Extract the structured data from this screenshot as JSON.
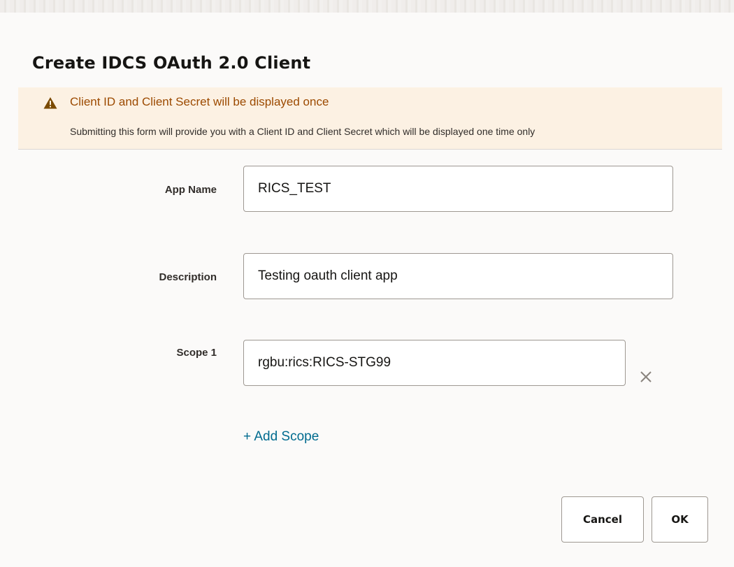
{
  "dialog": {
    "title": "Create IDCS OAuth 2.0 Client"
  },
  "banner": {
    "icon": "warning-triangle-icon",
    "title": "Client ID and Client Secret will be displayed once",
    "message": "Submitting this form will provide you with a Client ID and Client Secret which will be displayed one time only",
    "colors": {
      "background": "#fcf1e3",
      "title": "#9c4a00",
      "icon": "#7a4a00"
    }
  },
  "form": {
    "app_name": {
      "label": "App Name",
      "value": "RICS_TEST"
    },
    "description": {
      "label": "Description",
      "value": "Testing oauth client app"
    },
    "scopes": [
      {
        "label": "Scope 1",
        "value": "rgbu:rics:RICS-STG99",
        "clear_icon": "close-icon"
      }
    ],
    "add_scope_label": "+ Add Scope"
  },
  "footer": {
    "cancel_label": "Cancel",
    "ok_label": "OK"
  },
  "colors": {
    "link": "#006b8f",
    "text": "#161513"
  }
}
